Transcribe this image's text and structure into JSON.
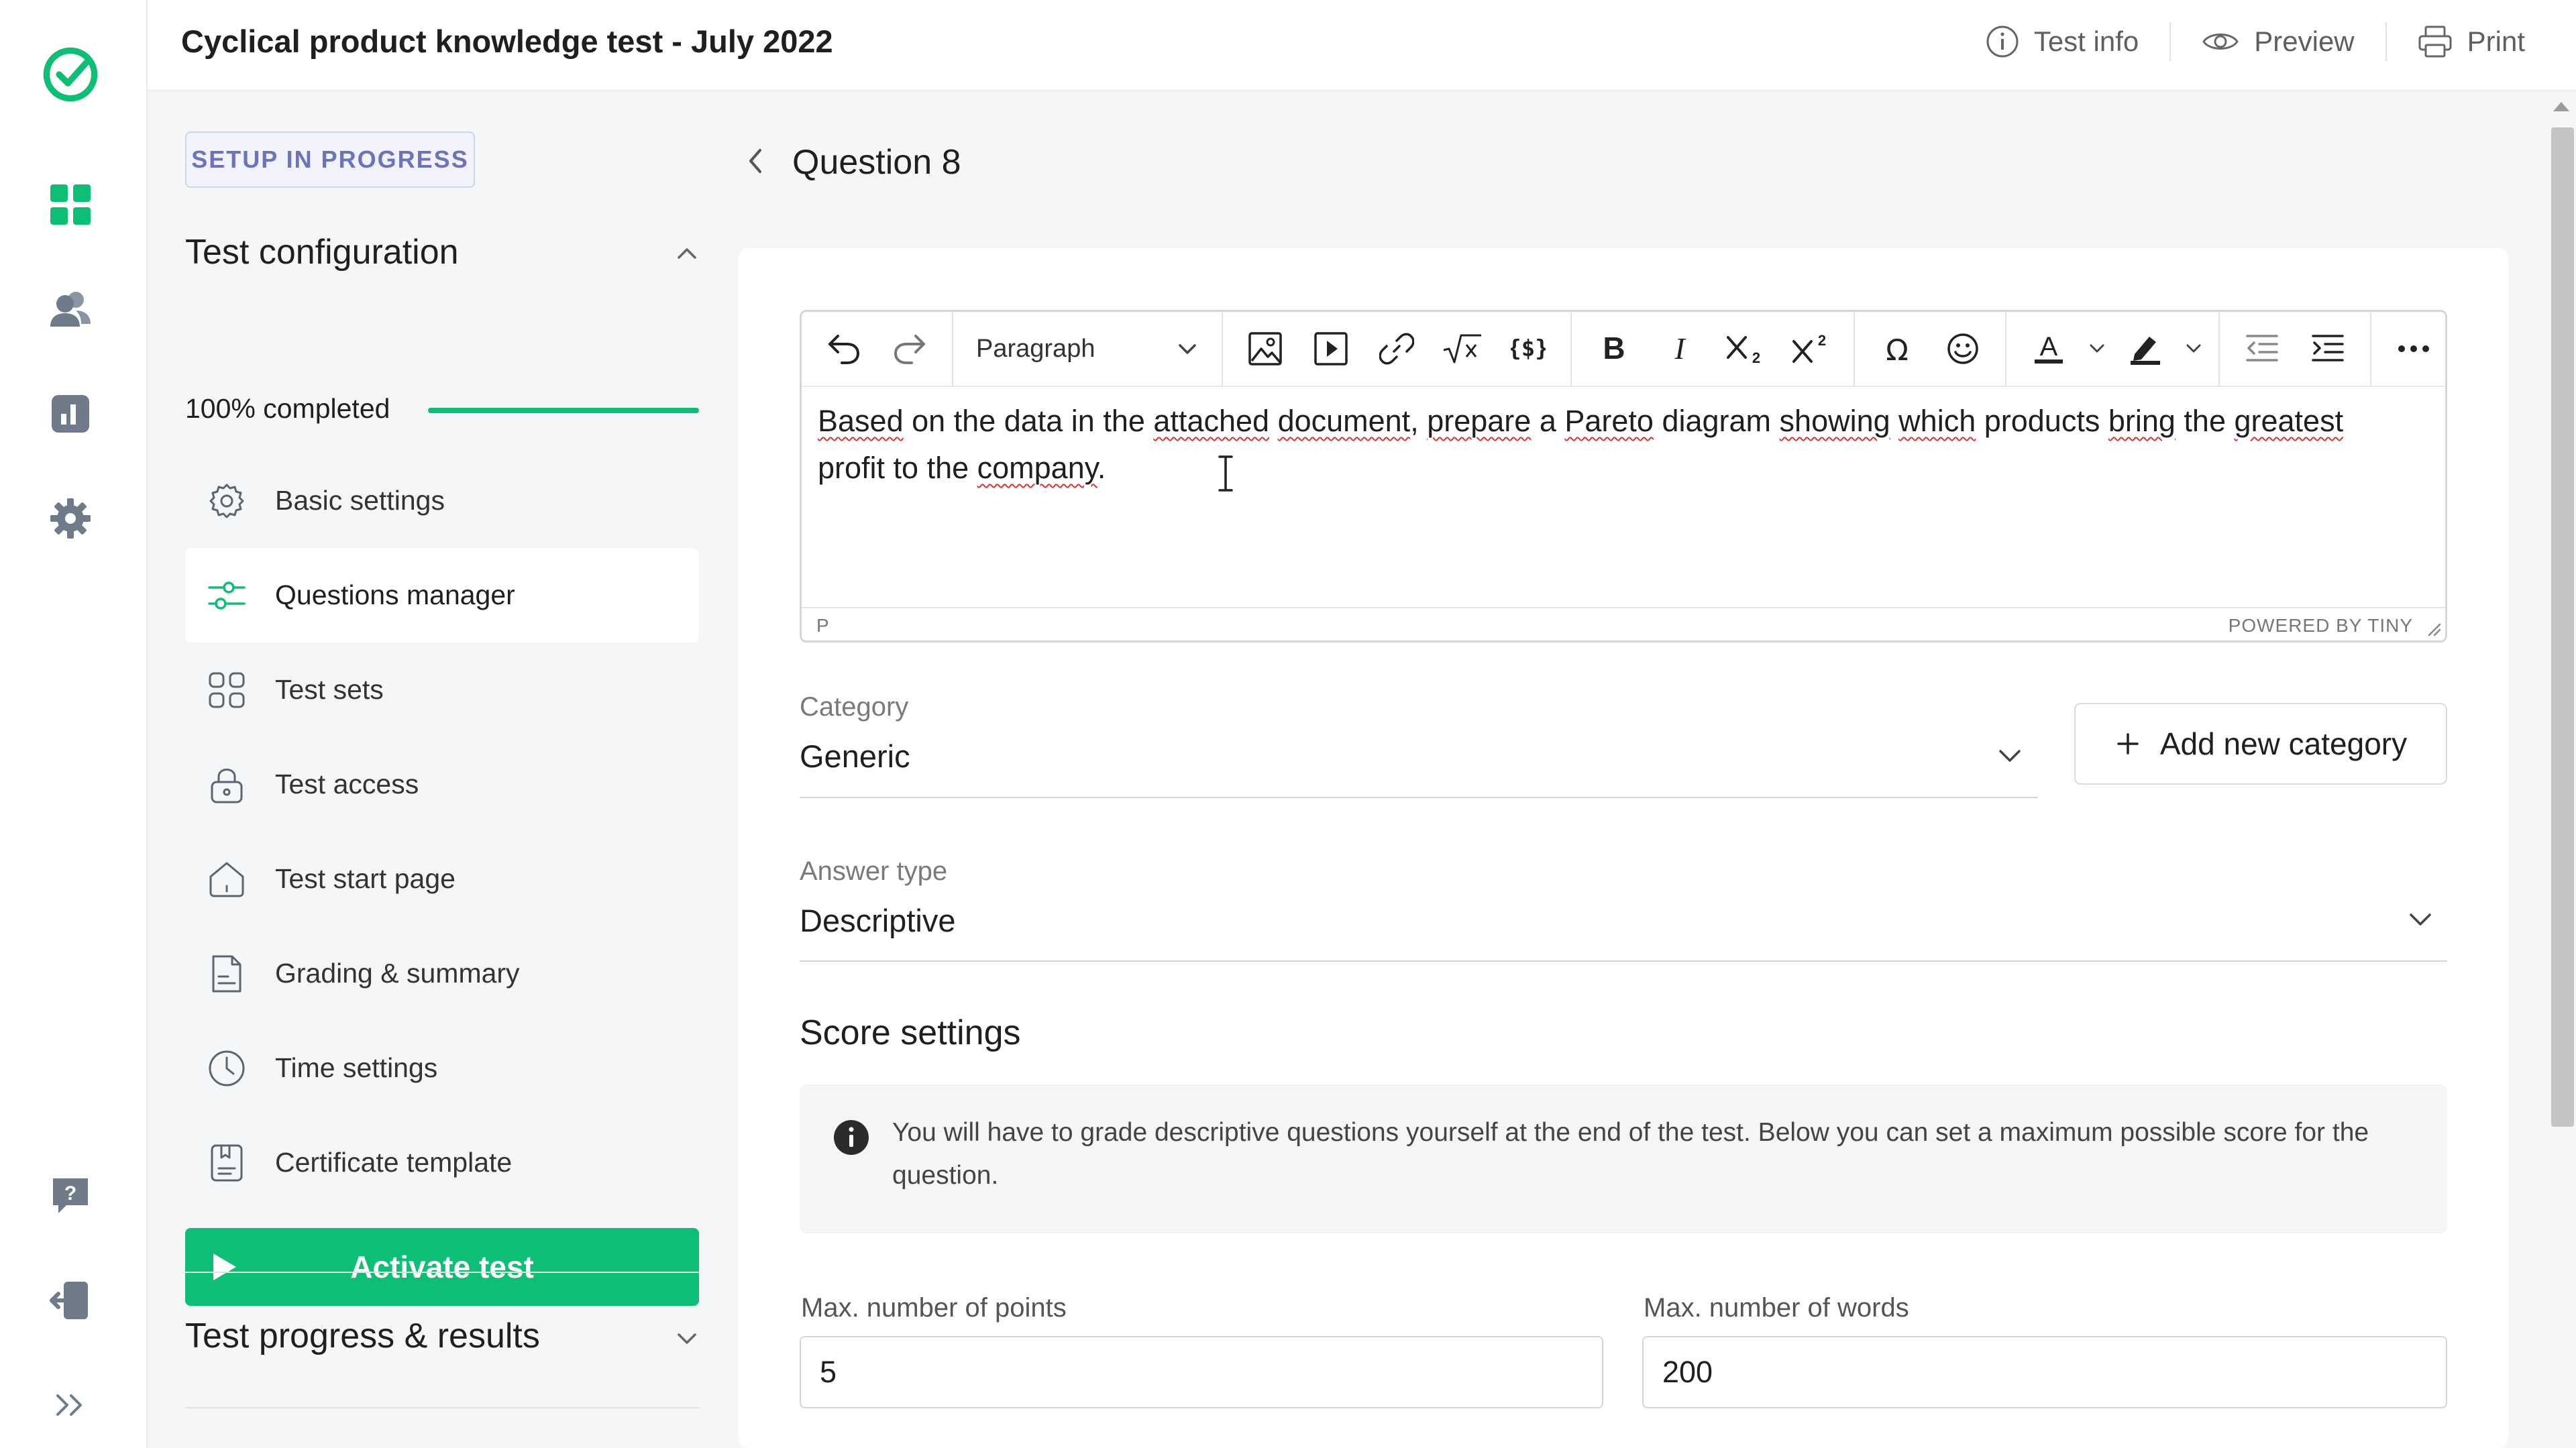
{
  "app": {
    "title": "Cyclical product knowledge test - July 2022"
  },
  "topbar": {
    "actions": [
      {
        "label": "Test info",
        "icon": "info-icon"
      },
      {
        "label": "Preview",
        "icon": "eye-icon"
      },
      {
        "label": "Print",
        "icon": "printer-icon"
      }
    ]
  },
  "rail": {
    "icons": [
      "logo-check-icon",
      "dashboard-grid-icon",
      "users-icon",
      "reports-chart-icon",
      "settings-gear-icon",
      "help-icon",
      "logout-icon",
      "expand-icon"
    ],
    "accent": "#0cbf74"
  },
  "sidebar": {
    "status_badge": "SETUP IN PROGRESS",
    "config_title": "Test configuration",
    "progress_label": "100% completed",
    "progress_value": 1.0,
    "items": [
      {
        "label": "Basic settings",
        "icon": "gear-icon"
      },
      {
        "label": "Questions manager",
        "icon": "sliders-icon",
        "active": true
      },
      {
        "label": "Test sets",
        "icon": "grid-squares-icon"
      },
      {
        "label": "Test access",
        "icon": "lock-icon"
      },
      {
        "label": "Test start page",
        "icon": "home-icon"
      },
      {
        "label": "Grading & summary",
        "icon": "document-icon"
      },
      {
        "label": "Time settings",
        "icon": "clock-icon"
      },
      {
        "label": "Certificate template",
        "icon": "certificate-icon"
      }
    ],
    "activate_label": "Activate test",
    "results_title": "Test progress & results"
  },
  "question": {
    "title": "Question 8"
  },
  "editor": {
    "block_format": "Paragraph",
    "text_line1": [
      {
        "t": "Based",
        "s": true
      },
      {
        "t": " on the data in the ",
        "s": false
      },
      {
        "t": "attached",
        "s": true
      },
      {
        "t": " ",
        "s": false
      },
      {
        "t": "document",
        "s": true
      },
      {
        "t": ", ",
        "s": false
      },
      {
        "t": "prepare",
        "s": true
      },
      {
        "t": " a ",
        "s": false
      },
      {
        "t": "Pareto",
        "s": true
      },
      {
        "t": " diagram ",
        "s": false
      },
      {
        "t": "showing",
        "s": true
      },
      {
        "t": " ",
        "s": false
      },
      {
        "t": "which",
        "s": true
      },
      {
        "t": " products ",
        "s": false
      },
      {
        "t": "bring",
        "s": true
      },
      {
        "t": " the ",
        "s": false
      },
      {
        "t": "greatest",
        "s": true
      }
    ],
    "text_line2": [
      {
        "t": "profit to the ",
        "s": false
      },
      {
        "t": "company",
        "s": true
      },
      {
        "t": ".",
        "s": false
      }
    ],
    "status_path": "P",
    "powered_by": "POWERED BY TINY"
  },
  "category": {
    "label": "Category",
    "value": "Generic",
    "add_label": "Add new category"
  },
  "answer_type": {
    "label": "Answer type",
    "value": "Descriptive"
  },
  "score": {
    "title": "Score settings",
    "info": "You will have to grade descriptive questions yourself at the end of the test. Below you can set a maximum possible score for the question.",
    "max_points_label": "Max. number of points",
    "max_points_value": "5",
    "max_words_label": "Max. number of words",
    "max_words_value": "200"
  }
}
